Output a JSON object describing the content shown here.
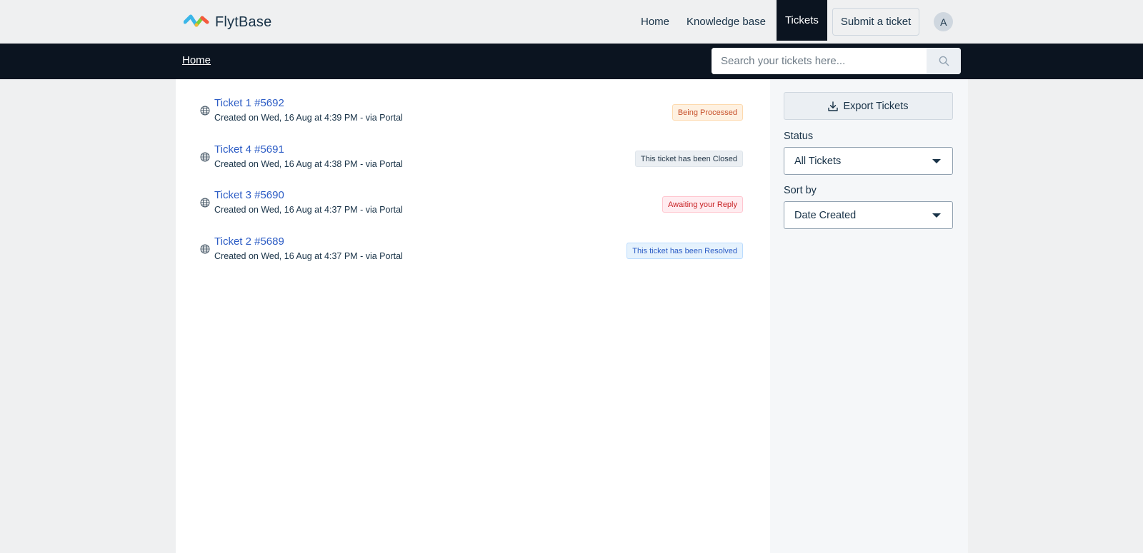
{
  "header": {
    "brand": "FlytBase",
    "nav": {
      "home": "Home",
      "knowledge_base": "Knowledge base",
      "tickets": "Tickets",
      "submit": "Submit a ticket"
    },
    "avatar_initial": "A"
  },
  "subbar": {
    "breadcrumb": "Home",
    "search_placeholder": "Search your tickets here..."
  },
  "tickets": [
    {
      "title": "Ticket 1 #5692",
      "meta": "Created on Wed, 16 Aug at 4:39 PM - via Portal",
      "status": "Being Processed"
    },
    {
      "title": "Ticket 4 #5691",
      "meta": "Created on Wed, 16 Aug at 4:38 PM - via Portal",
      "status": "This ticket has been Closed"
    },
    {
      "title": "Ticket 3 #5690",
      "meta": "Created on Wed, 16 Aug at 4:37 PM - via Portal",
      "status": "Awaiting your Reply"
    },
    {
      "title": "Ticket 2 #5689",
      "meta": "Created on Wed, 16 Aug at 4:37 PM - via Portal",
      "status": "This ticket has been Resolved"
    }
  ],
  "sidebar": {
    "export_label": "Export Tickets",
    "status_label": "Status",
    "status_value": "All Tickets",
    "sort_label": "Sort by",
    "sort_value": "Date Created"
  },
  "colors": {
    "dark_bar": "#0b1420",
    "link": "#2c5cc5",
    "processed_bg": "#fef1e1",
    "processed_text": "#c7502a",
    "closed_bg": "#ebeff3",
    "awaiting_bg": "#ffecf0",
    "awaiting_text": "#c82124",
    "resolved_bg": "#e5f2fd",
    "resolved_text": "#2c5cc5"
  }
}
